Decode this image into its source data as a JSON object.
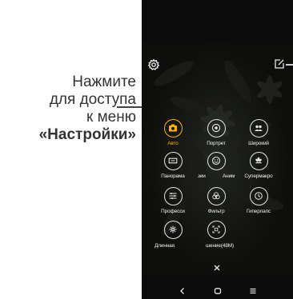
{
  "callout": {
    "line1": "Нажмите",
    "line2": "для доступа",
    "line3": "к меню",
    "line4": "«Настройки»"
  },
  "colors": {
    "accent": "#ffb300",
    "icon": "#e6e6e6",
    "background": "#0b0b0b"
  },
  "modes": [
    {
      "label": "Авто",
      "icon": "camera-icon",
      "active": true
    },
    {
      "label": "Портрет",
      "icon": "portrait-icon",
      "active": false
    },
    {
      "label": "Широкий",
      "icon": "wide-angle-icon",
      "active": false
    },
    {
      "label": "Панорама",
      "icon": "panorama-icon",
      "active": false
    },
    {
      "label": "зии",
      "icon": "smile-icon",
      "active": false
    },
    {
      "label": "Аним",
      "icon": "",
      "active": false
    },
    {
      "label": "Супермакро",
      "icon": "macro-flower-icon",
      "active": false
    },
    {
      "label": "Професси",
      "icon": "pro-sliders-icon",
      "active": false
    },
    {
      "label": "Фильтр",
      "icon": "filter-icon",
      "active": false
    },
    {
      "label": "Гиперлапс",
      "icon": "hyperlapse-icon",
      "active": false
    },
    {
      "label": "Длинная",
      "icon": "long-exposure-icon",
      "active": false
    },
    {
      "label": "шение(48М)",
      "icon": "high-res-icon",
      "active": false
    }
  ],
  "toolbar": {
    "settings_icon": "gear-icon",
    "edit_icon": "edit-icon",
    "close_icon": "close-icon"
  },
  "navbar": {
    "back_icon": "back-icon",
    "home_icon": "home-icon",
    "recents_icon": "recents-icon"
  }
}
